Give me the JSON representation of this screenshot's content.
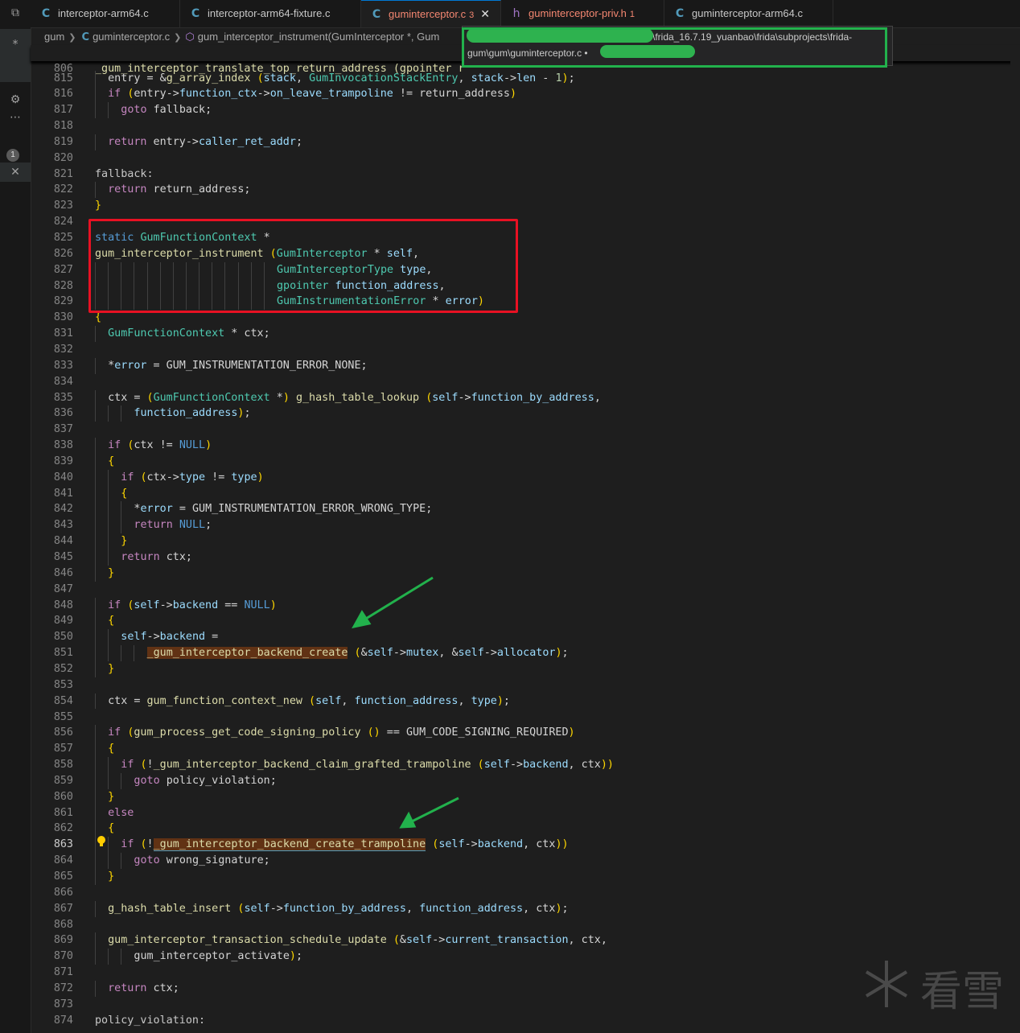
{
  "tabs": [
    {
      "name": "tab-interceptor-arm64",
      "icon": "C",
      "label": "interceptor-arm64.c",
      "left": 0,
      "width": 186
    },
    {
      "name": "tab-interceptor-arm64-fixture",
      "icon": "C",
      "label": "interceptor-arm64-fixture.c"
    },
    {
      "name": "tab-guminterceptor",
      "icon": "C",
      "label": "guminterceptor.c",
      "count": "3",
      "close": "✕"
    },
    {
      "name": "tab-guminterceptor-priv",
      "icon": "h",
      "label": "guminterceptor-priv.h",
      "count": "1"
    },
    {
      "name": "tab-guminterceptor-arm64",
      "icon": "C",
      "label": "guminterceptor-arm64.c"
    }
  ],
  "breadcrumb": {
    "root": "gum",
    "file": "guminterceptor.c",
    "symbol": "gum_interceptor_instrument(GumInterceptor *, Gum"
  },
  "tooltip": {
    "line1": "\\frida_16.7.19_yuanbao\\frida\\subprojects\\frida-",
    "line2": "gum\\gum\\guminterceptor.c • "
  },
  "activity": {
    "badge": "1"
  },
  "watermark": {
    "text": "看雪"
  },
  "sticky": {
    "num": "806",
    "code": "_gum_interceptor_translate_top_return_address (gpointer r"
  },
  "lines": [
    {
      "n": "815",
      "t": "entry = &g_array_index (stack, GumInvocationStackEntry, stack->len - 1);"
    },
    {
      "n": "816",
      "t": "if (entry->function_ctx->on_leave_trampoline != return_address)"
    },
    {
      "n": "817",
      "t": "goto fallback;"
    },
    {
      "n": "818",
      "t": ""
    },
    {
      "n": "819",
      "t": "return entry->caller_ret_addr;"
    },
    {
      "n": "820",
      "t": ""
    },
    {
      "n": "821",
      "t": "fallback:"
    },
    {
      "n": "822",
      "t": "return return_address;"
    },
    {
      "n": "823",
      "t": "}"
    },
    {
      "n": "824",
      "t": ""
    },
    {
      "n": "825",
      "t": "static GumFunctionContext *"
    },
    {
      "n": "826",
      "t": "gum_interceptor_instrument (GumInterceptor * self,"
    },
    {
      "n": "827",
      "t": "GumInterceptorType type,"
    },
    {
      "n": "828",
      "t": "gpointer function_address,"
    },
    {
      "n": "829",
      "t": "GumInstrumentationError * error)"
    },
    {
      "n": "830",
      "t": "{"
    },
    {
      "n": "831",
      "t": "GumFunctionContext * ctx;"
    },
    {
      "n": "832",
      "t": ""
    },
    {
      "n": "833",
      "t": "*error = GUM_INSTRUMENTATION_ERROR_NONE;"
    },
    {
      "n": "834",
      "t": ""
    },
    {
      "n": "835",
      "t": "ctx = (GumFunctionContext *) g_hash_table_lookup (self->function_by_address,"
    },
    {
      "n": "836",
      "t": "function_address);"
    },
    {
      "n": "837",
      "t": ""
    },
    {
      "n": "838",
      "t": "if (ctx != NULL)"
    },
    {
      "n": "839",
      "t": "{"
    },
    {
      "n": "840",
      "t": "if (ctx->type != type)"
    },
    {
      "n": "841",
      "t": "{"
    },
    {
      "n": "842",
      "t": "*error = GUM_INSTRUMENTATION_ERROR_WRONG_TYPE;"
    },
    {
      "n": "843",
      "t": "return NULL;"
    },
    {
      "n": "844",
      "t": "}"
    },
    {
      "n": "845",
      "t": "return ctx;"
    },
    {
      "n": "846",
      "t": "}"
    },
    {
      "n": "847",
      "t": ""
    },
    {
      "n": "848",
      "t": "if (self->backend == NULL)"
    },
    {
      "n": "849",
      "t": "{"
    },
    {
      "n": "850",
      "t": "self->backend ="
    },
    {
      "n": "851",
      "t": "_gum_interceptor_backend_create (&self->mutex, &self->allocator);"
    },
    {
      "n": "852",
      "t": "}"
    },
    {
      "n": "853",
      "t": ""
    },
    {
      "n": "854",
      "t": "ctx = gum_function_context_new (self, function_address, type);"
    },
    {
      "n": "855",
      "t": ""
    },
    {
      "n": "856",
      "t": "if (gum_process_get_code_signing_policy () == GUM_CODE_SIGNING_REQUIRED)"
    },
    {
      "n": "857",
      "t": "{"
    },
    {
      "n": "858",
      "t": "if (!_gum_interceptor_backend_claim_grafted_trampoline (self->backend, ctx))"
    },
    {
      "n": "859",
      "t": "goto policy_violation;"
    },
    {
      "n": "860",
      "t": "}"
    },
    {
      "n": "861",
      "t": "else"
    },
    {
      "n": "862",
      "t": "{"
    },
    {
      "n": "863",
      "t": "if (!_gum_interceptor_backend_create_trampoline (self->backend, ctx))"
    },
    {
      "n": "864",
      "t": "goto wrong_signature;"
    },
    {
      "n": "865",
      "t": "}"
    },
    {
      "n": "866",
      "t": ""
    },
    {
      "n": "867",
      "t": "g_hash_table_insert (self->function_by_address, function_address, ctx);"
    },
    {
      "n": "868",
      "t": ""
    },
    {
      "n": "869",
      "t": "gum_interceptor_transaction_schedule_update (&self->current_transaction, ctx,"
    },
    {
      "n": "870",
      "t": "gum_interceptor_activate);"
    },
    {
      "n": "871",
      "t": ""
    },
    {
      "n": "872",
      "t": "return ctx;"
    },
    {
      "n": "873",
      "t": ""
    },
    {
      "n": "874",
      "t": "policy_violation:"
    }
  ]
}
